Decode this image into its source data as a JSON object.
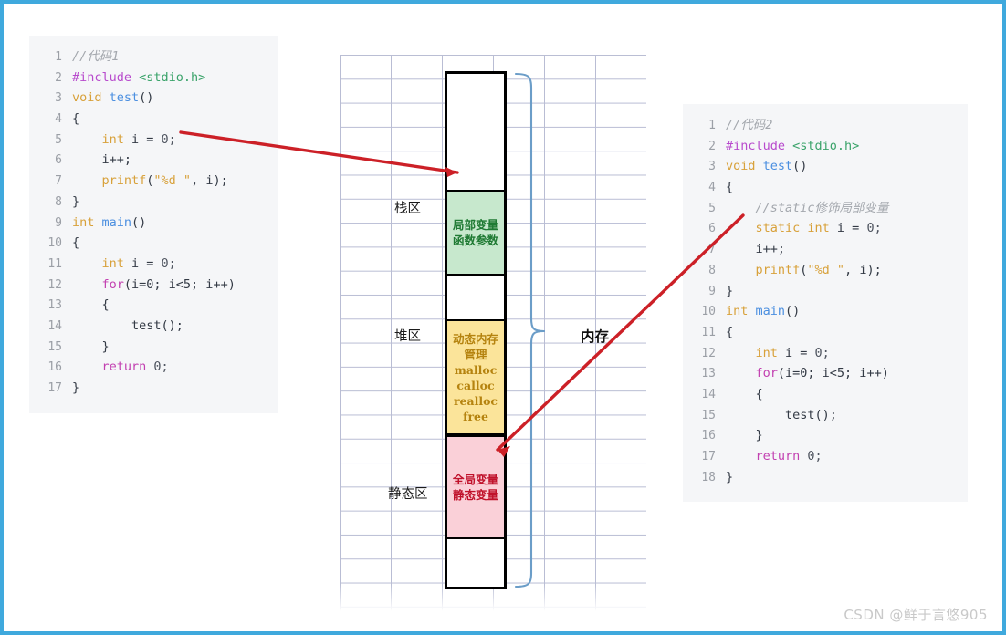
{
  "watermark": "CSDN @鲜于言悠905",
  "colors": {
    "border": "#3fa9dd",
    "grid_line": "#b9bdd4",
    "code_bg": "#f5f6f8",
    "stack_fill": "#c7e8cd",
    "stack_text": "#1f7a33",
    "heap_fill": "#fbe49a",
    "heap_text": "#b5830f",
    "static_fill": "#fad0d8",
    "static_text": "#c0112b",
    "arrow": "#cc2027",
    "brace": "#6b9dc8"
  },
  "code_left": {
    "name": "code-sample-1",
    "lines": [
      {
        "n": "1",
        "tokens": [
          {
            "t": "//代码1",
            "c": "t-cmt"
          }
        ]
      },
      {
        "n": "2",
        "tokens": [
          {
            "t": "#include ",
            "c": "t-pre"
          },
          {
            "t": "<stdio.h>",
            "c": "t-inc"
          }
        ]
      },
      {
        "n": "3",
        "tokens": [
          {
            "t": "void ",
            "c": "t-kw"
          },
          {
            "t": "test",
            "c": "t-fn"
          },
          {
            "t": "()",
            "c": "t-plain"
          }
        ]
      },
      {
        "n": "4",
        "tokens": [
          {
            "t": "{",
            "c": "t-plain"
          }
        ]
      },
      {
        "n": "5",
        "tokens": [
          {
            "t": "    int ",
            "c": "t-kw"
          },
          {
            "t": "i = ",
            "c": "t-plain"
          },
          {
            "t": "0;",
            "c": "t-num"
          }
        ]
      },
      {
        "n": "6",
        "tokens": [
          {
            "t": "    i++;",
            "c": "t-plain"
          }
        ]
      },
      {
        "n": "7",
        "tokens": [
          {
            "t": "    printf",
            "c": "t-fn2"
          },
          {
            "t": "(",
            "c": "t-plain"
          },
          {
            "t": "\"%d \"",
            "c": "t-str"
          },
          {
            "t": ", i);",
            "c": "t-plain"
          }
        ]
      },
      {
        "n": "8",
        "tokens": [
          {
            "t": "}",
            "c": "t-plain"
          }
        ]
      },
      {
        "n": "9",
        "tokens": [
          {
            "t": "int ",
            "c": "t-kw"
          },
          {
            "t": "main",
            "c": "t-fn"
          },
          {
            "t": "()",
            "c": "t-plain"
          }
        ]
      },
      {
        "n": "10",
        "tokens": [
          {
            "t": "{",
            "c": "t-plain"
          }
        ]
      },
      {
        "n": "11",
        "tokens": [
          {
            "t": "    int ",
            "c": "t-kw"
          },
          {
            "t": "i = ",
            "c": "t-plain"
          },
          {
            "t": "0;",
            "c": "t-num"
          }
        ]
      },
      {
        "n": "12",
        "tokens": [
          {
            "t": "    for",
            "c": "t-kw2"
          },
          {
            "t": "(i=0; i<5; i++)",
            "c": "t-plain"
          }
        ]
      },
      {
        "n": "13",
        "tokens": [
          {
            "t": "    {",
            "c": "t-plain"
          }
        ]
      },
      {
        "n": "14",
        "tokens": [
          {
            "t": "        test();",
            "c": "t-plain"
          }
        ]
      },
      {
        "n": "15",
        "tokens": [
          {
            "t": "    }",
            "c": "t-plain"
          }
        ]
      },
      {
        "n": "16",
        "tokens": [
          {
            "t": "    return ",
            "c": "t-kw2"
          },
          {
            "t": "0;",
            "c": "t-num"
          }
        ]
      },
      {
        "n": "17",
        "tokens": [
          {
            "t": "}",
            "c": "t-plain"
          }
        ]
      }
    ]
  },
  "code_right": {
    "name": "code-sample-2",
    "lines": [
      {
        "n": "1",
        "tokens": [
          {
            "t": "//代码2",
            "c": "t-cmt"
          }
        ]
      },
      {
        "n": "2",
        "tokens": [
          {
            "t": "#include ",
            "c": "t-pre"
          },
          {
            "t": "<stdio.h>",
            "c": "t-inc"
          }
        ]
      },
      {
        "n": "3",
        "tokens": [
          {
            "t": "void ",
            "c": "t-kw"
          },
          {
            "t": "test",
            "c": "t-fn"
          },
          {
            "t": "()",
            "c": "t-plain"
          }
        ]
      },
      {
        "n": "4",
        "tokens": [
          {
            "t": "{",
            "c": "t-plain"
          }
        ]
      },
      {
        "n": "5",
        "tokens": [
          {
            "t": "    //static修饰局部变量",
            "c": "t-cmt"
          }
        ]
      },
      {
        "n": "6",
        "tokens": [
          {
            "t": "    static int ",
            "c": "t-kw"
          },
          {
            "t": "i = ",
            "c": "t-plain"
          },
          {
            "t": "0;",
            "c": "t-num"
          }
        ]
      },
      {
        "n": "7",
        "tokens": [
          {
            "t": "    i++;",
            "c": "t-plain"
          }
        ]
      },
      {
        "n": "8",
        "tokens": [
          {
            "t": "    printf",
            "c": "t-fn2"
          },
          {
            "t": "(",
            "c": "t-plain"
          },
          {
            "t": "\"%d \"",
            "c": "t-str"
          },
          {
            "t": ", i);",
            "c": "t-plain"
          }
        ]
      },
      {
        "n": "9",
        "tokens": [
          {
            "t": "}",
            "c": "t-plain"
          }
        ]
      },
      {
        "n": "10",
        "tokens": [
          {
            "t": "int ",
            "c": "t-kw"
          },
          {
            "t": "main",
            "c": "t-fn"
          },
          {
            "t": "()",
            "c": "t-plain"
          }
        ]
      },
      {
        "n": "11",
        "tokens": [
          {
            "t": "{",
            "c": "t-plain"
          }
        ]
      },
      {
        "n": "12",
        "tokens": [
          {
            "t": "    int ",
            "c": "t-kw"
          },
          {
            "t": "i = ",
            "c": "t-plain"
          },
          {
            "t": "0;",
            "c": "t-num"
          }
        ]
      },
      {
        "n": "13",
        "tokens": [
          {
            "t": "    for",
            "c": "t-kw2"
          },
          {
            "t": "(i=0; i<5; i++)",
            "c": "t-plain"
          }
        ]
      },
      {
        "n": "14",
        "tokens": [
          {
            "t": "    {",
            "c": "t-plain"
          }
        ]
      },
      {
        "n": "15",
        "tokens": [
          {
            "t": "        test();",
            "c": "t-plain"
          }
        ]
      },
      {
        "n": "16",
        "tokens": [
          {
            "t": "    }",
            "c": "t-plain"
          }
        ]
      },
      {
        "n": "17",
        "tokens": [
          {
            "t": "    return ",
            "c": "t-kw2"
          },
          {
            "t": "0;",
            "c": "t-num"
          }
        ]
      },
      {
        "n": "18",
        "tokens": [
          {
            "t": "}",
            "c": "t-plain"
          }
        ]
      }
    ]
  },
  "memory": {
    "title": "内存",
    "zones": {
      "stack": "栈区",
      "heap": "堆区",
      "static": "静态区"
    },
    "cells": {
      "stack": [
        "局部变量",
        "函数参数"
      ],
      "heap": [
        "动态内存",
        "管理",
        "malloc",
        "calloc",
        "realloc",
        "free"
      ],
      "static": [
        "全局变量",
        "静态变量"
      ]
    }
  }
}
